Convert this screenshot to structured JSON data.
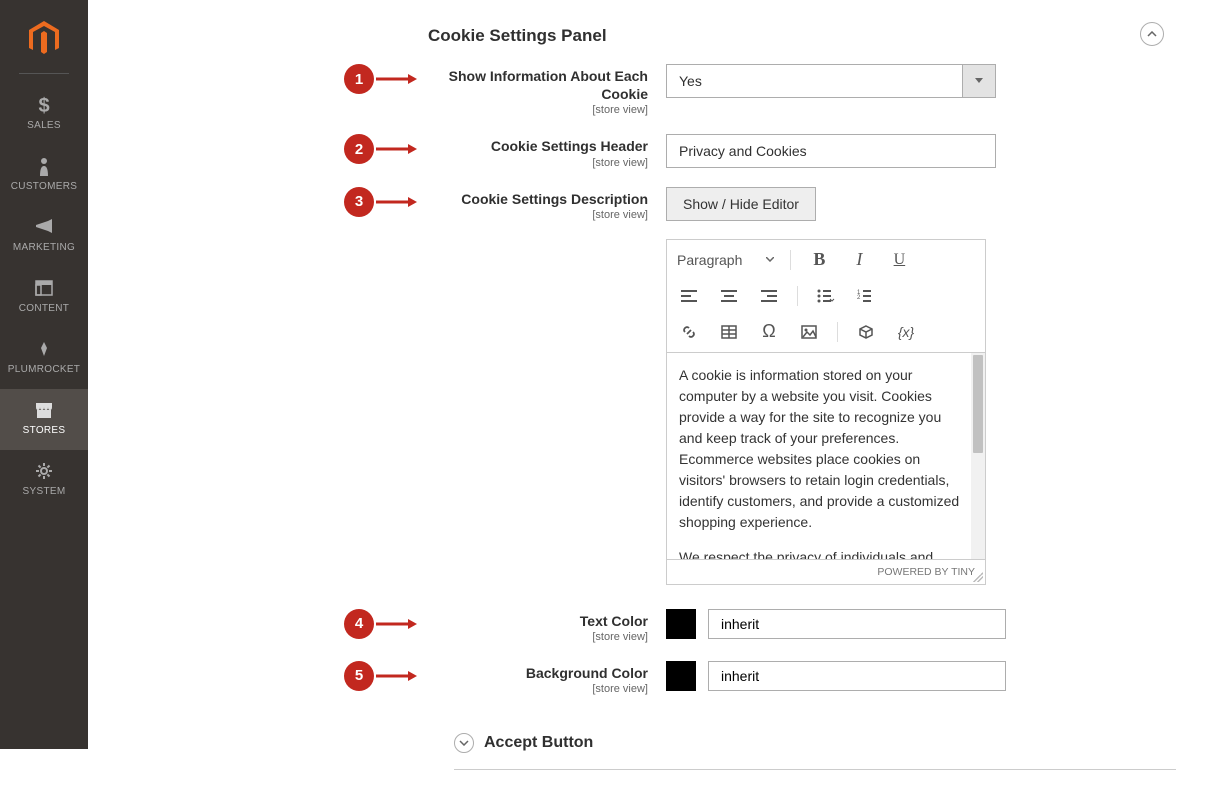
{
  "sidebar": {
    "items": [
      {
        "label": "SALES"
      },
      {
        "label": "CUSTOMERS"
      },
      {
        "label": "MARKETING"
      },
      {
        "label": "CONTENT"
      },
      {
        "label": "PLUMROCKET"
      },
      {
        "label": "STORES"
      },
      {
        "label": "SYSTEM"
      }
    ]
  },
  "section": {
    "title": "Cookie Settings Panel"
  },
  "fields": {
    "show_info": {
      "label": "Show Information About Each Cookie",
      "scope": "[store view]",
      "value": "Yes"
    },
    "header": {
      "label": "Cookie Settings Header",
      "scope": "[store view]",
      "value": "Privacy and Cookies"
    },
    "description": {
      "label": "Cookie Settings Description",
      "scope": "[store view]",
      "button": "Show / Hide Editor"
    },
    "text_color": {
      "label": "Text Color",
      "scope": "[store view]",
      "value": "inherit"
    },
    "bg_color": {
      "label": "Background Color",
      "scope": "[store view]",
      "value": "inherit"
    }
  },
  "editor": {
    "format_select": "Paragraph",
    "content_p1": "A cookie is information stored on your computer by a website you visit. Cookies provide a way for the site to recognize you and keep track of your preferences. Ecommerce websites place cookies on visitors' browsers to retain login credentials, identify customers, and provide a customized shopping experience.",
    "content_p2": "We respect the privacy of individuals and",
    "footer": "POWERED BY TINY"
  },
  "badges": {
    "b1": "1",
    "b2": "2",
    "b3": "3",
    "b4": "4",
    "b5": "5"
  },
  "subsection": {
    "title": "Accept Button"
  }
}
